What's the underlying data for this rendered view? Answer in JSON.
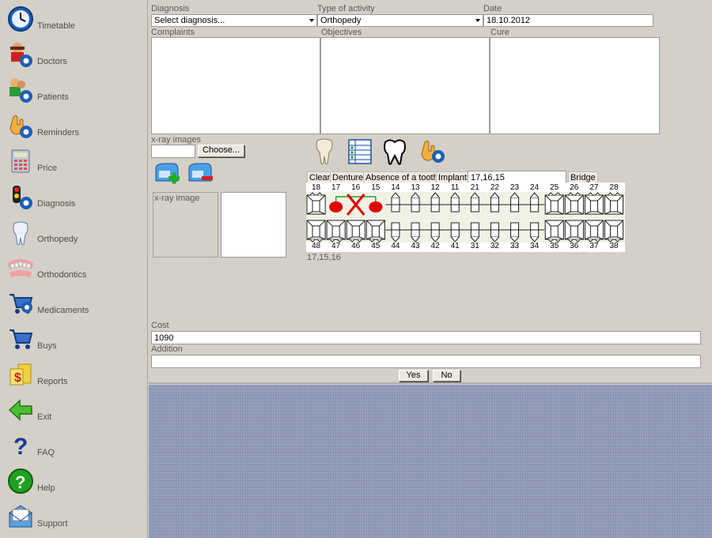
{
  "sidebar": {
    "items": [
      {
        "label": "Timetable",
        "icon": "clock-icon"
      },
      {
        "label": "Doctors",
        "icon": "doctor-icon"
      },
      {
        "label": "Patients",
        "icon": "patients-icon"
      },
      {
        "label": "Reminders",
        "icon": "reminder-icon"
      },
      {
        "label": "Price",
        "icon": "calculator-icon"
      },
      {
        "label": "Diagnosis",
        "icon": "diagnosis-icon"
      },
      {
        "label": "Orthopedy",
        "icon": "tooth-icon"
      },
      {
        "label": "Orthodontics",
        "icon": "braces-icon"
      },
      {
        "label": "Medicaments",
        "icon": "cart-icon"
      },
      {
        "label": "Buys",
        "icon": "cart-icon"
      },
      {
        "label": "Reports",
        "icon": "money-reports-icon"
      },
      {
        "label": "Exit",
        "icon": "arrow-left-icon"
      },
      {
        "label": "FAQ",
        "icon": "question-mark-icon"
      },
      {
        "label": "Help",
        "icon": "help-icon"
      },
      {
        "label": "Support",
        "icon": "mail-support-icon"
      }
    ]
  },
  "form": {
    "diagnosis": {
      "label": "Diagnosis",
      "value": "Select diagnosis..."
    },
    "activity": {
      "label": "Type of activity",
      "value": "Orthopedy"
    },
    "date": {
      "label": "Date",
      "value": "18.10.2012"
    },
    "complaints_label": "Complaints",
    "objectives_label": "Objectives",
    "cure_label": "Cure",
    "xray": {
      "images_label": "x-ray images",
      "choose_label": "Choose...",
      "image_label": "x-ray image"
    },
    "toolbar": {
      "clear": "Clear",
      "denture": "Denture",
      "absence": "Absence of a tooth",
      "implant": "Implant",
      "selected_value": "17,16,15",
      "bridge": "Bridge"
    },
    "teeth": {
      "upper": [
        "18",
        "17",
        "16",
        "15",
        "14",
        "13",
        "12",
        "11",
        "21",
        "22",
        "23",
        "24",
        "25",
        "26",
        "27",
        "28"
      ],
      "lower": [
        "48",
        "47",
        "46",
        "45",
        "44",
        "43",
        "42",
        "41",
        "31",
        "32",
        "33",
        "34",
        "35",
        "36",
        "37",
        "38"
      ],
      "missing": [
        "16"
      ],
      "bridge_abutments": [
        "17",
        "15"
      ]
    },
    "selected_summary": "17,15,16",
    "cost": {
      "label": "Cost",
      "value": "1090"
    },
    "addition": {
      "label": "Addition",
      "value": ""
    },
    "yes_label": "Yes",
    "no_label": "No"
  },
  "colors": {
    "window_bg": "#d4d0c8",
    "desktop_bg": "#8f9ab8",
    "bridge_red": "#e00000"
  }
}
